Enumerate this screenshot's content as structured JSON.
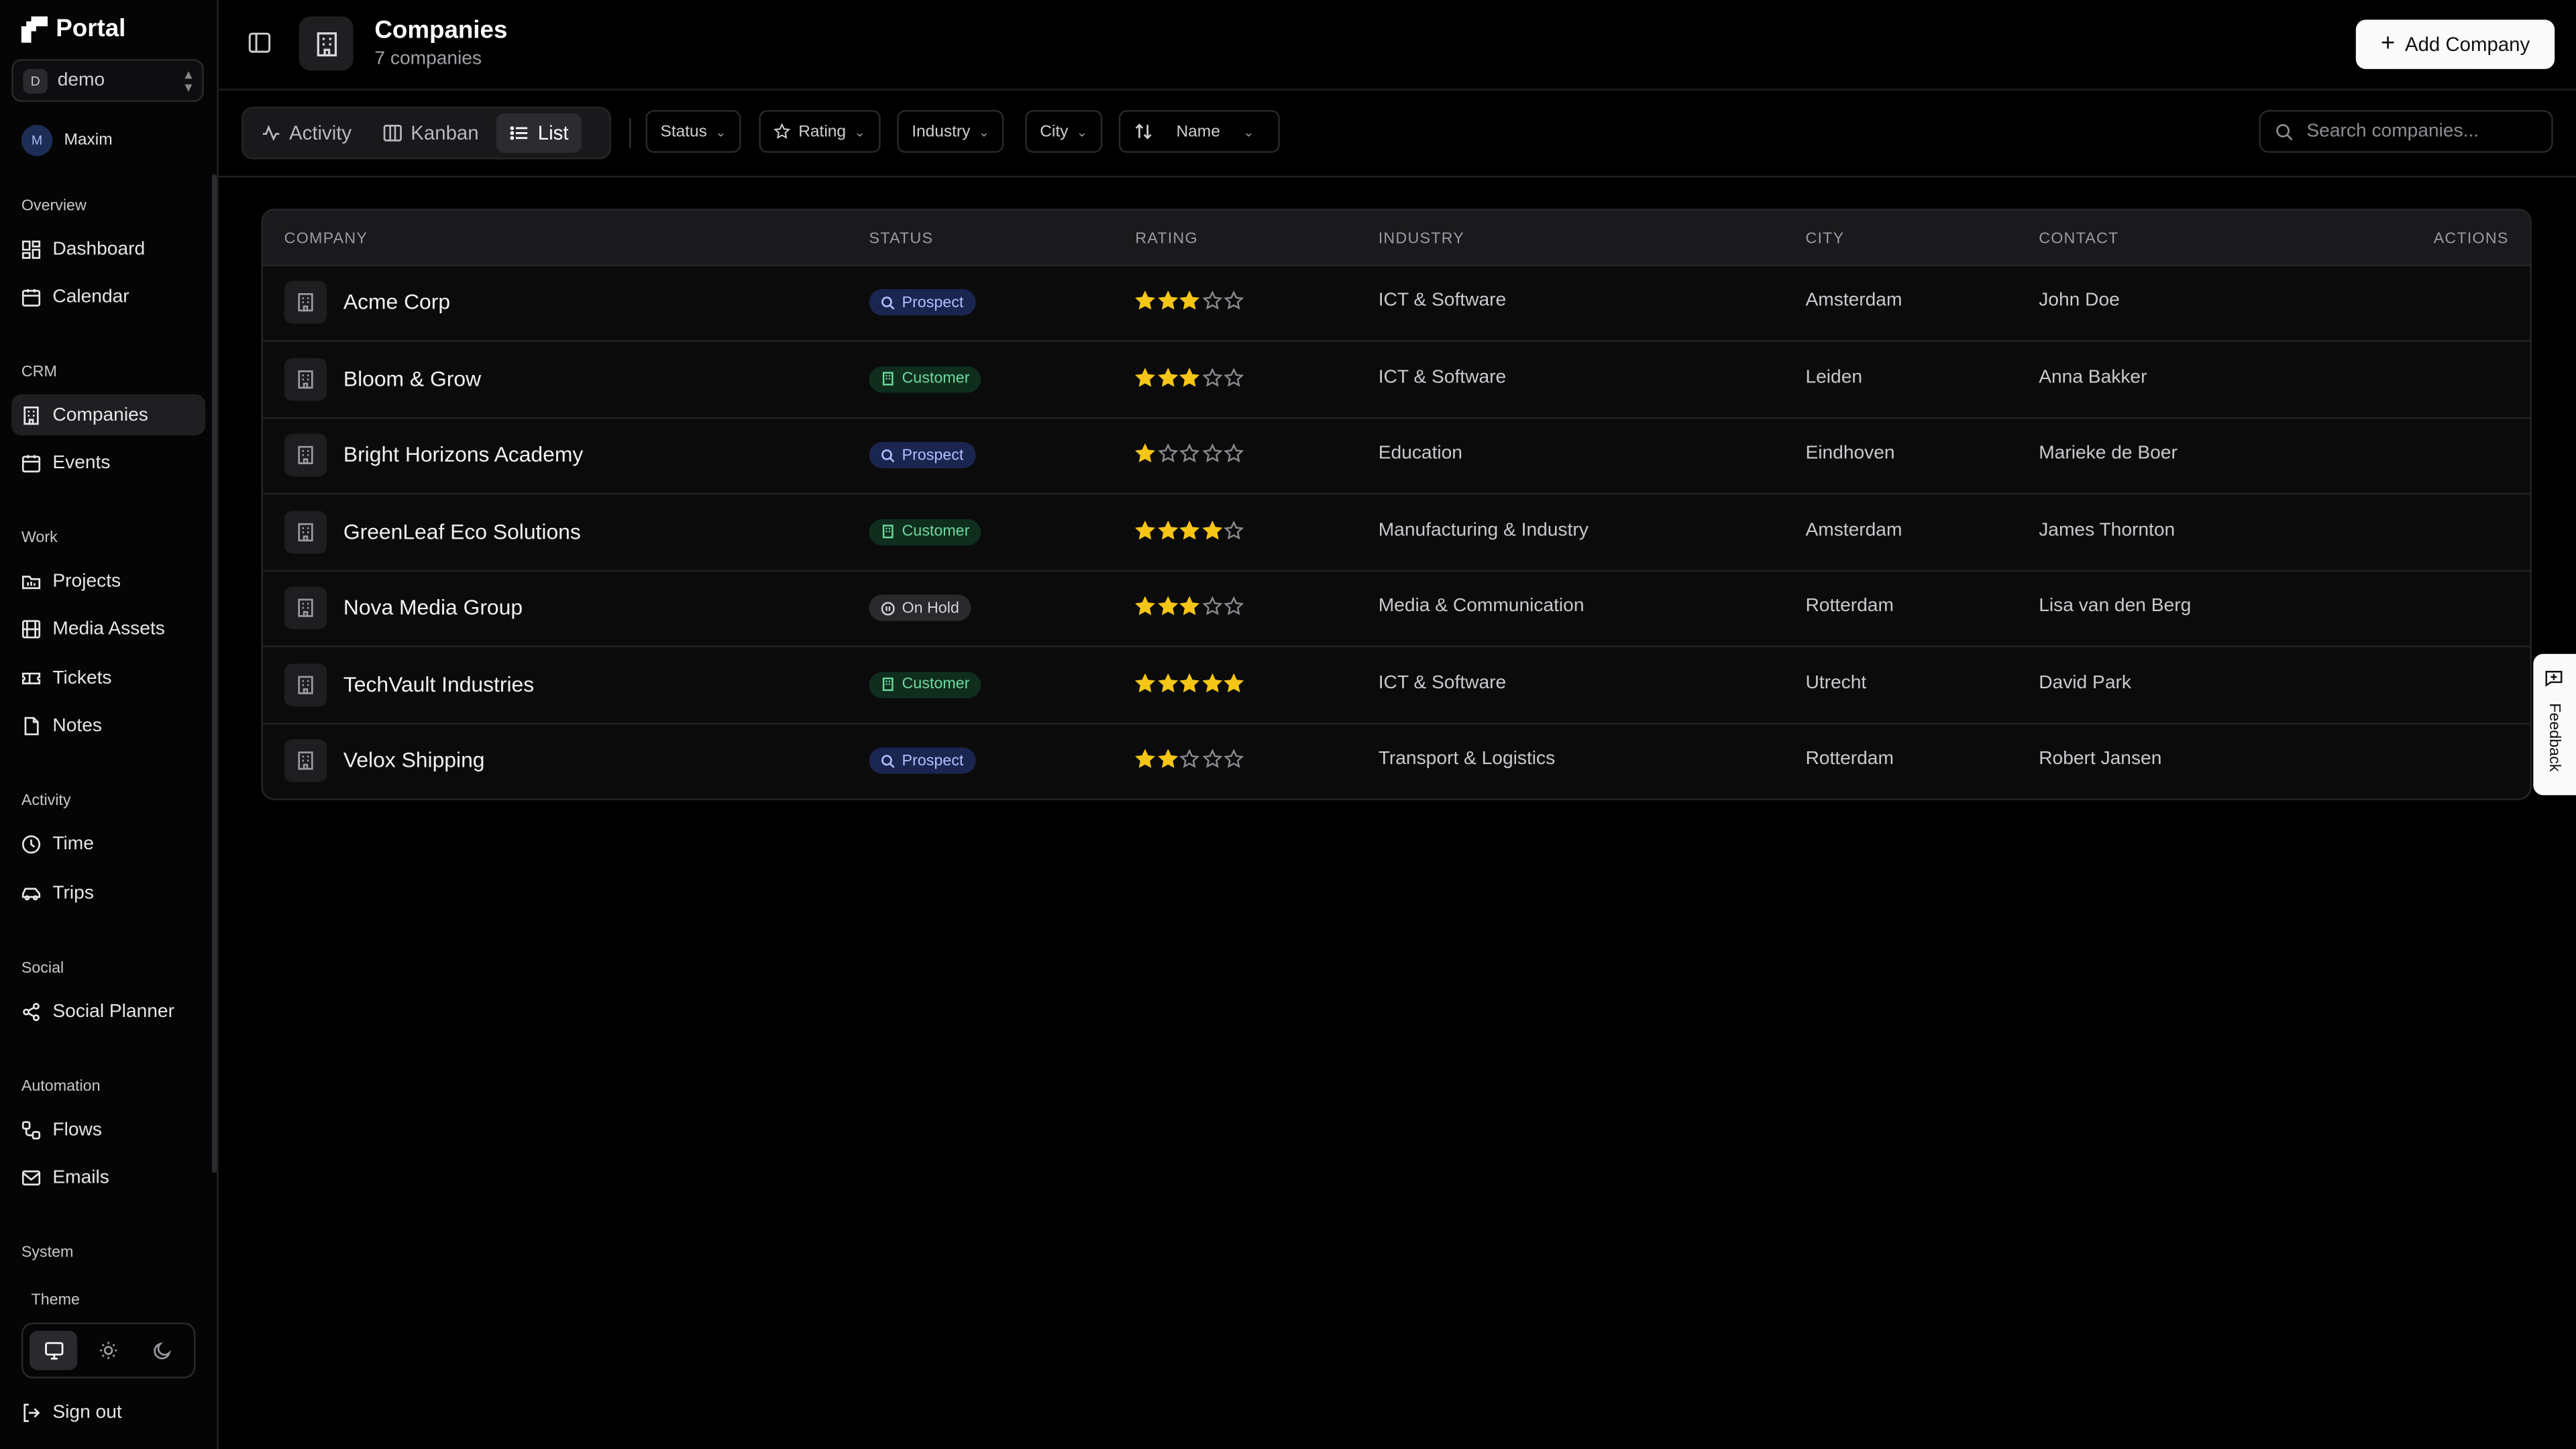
{
  "app": {
    "name": "Portal",
    "workspace_initial": "D",
    "workspace": "demo",
    "user_initial": "M",
    "user_name": "Maxim"
  },
  "sidebar": {
    "sections": {
      "overview": "Overview",
      "crm": "CRM",
      "work": "Work",
      "activity": "Activity",
      "social": "Social",
      "automation": "Automation",
      "system": "System"
    },
    "items": {
      "dashboard": "Dashboard",
      "calendar": "Calendar",
      "companies": "Companies",
      "events": "Events",
      "projects": "Projects",
      "media_assets": "Media Assets",
      "tickets": "Tickets",
      "notes": "Notes",
      "time": "Time",
      "trips": "Trips",
      "social_planner": "Social Planner",
      "flows": "Flows",
      "emails": "Emails"
    },
    "theme_label": "Theme",
    "theme_selected": "system",
    "sign_out": "Sign out"
  },
  "header": {
    "title": "Companies",
    "subtitle": "7 companies",
    "add_button": "Add Company"
  },
  "toolbar": {
    "views": {
      "activity": "Activity",
      "kanban": "Kanban",
      "list": "List"
    },
    "active_view": "List",
    "filters": {
      "status": "Status",
      "rating": "Rating",
      "industry": "Industry",
      "city": "City"
    },
    "sort": "Name",
    "search_placeholder": "Search companies..."
  },
  "table": {
    "columns": {
      "company": "COMPANY",
      "status": "STATUS",
      "rating": "RATING",
      "industry": "INDUSTRY",
      "city": "CITY",
      "contact": "CONTACT",
      "actions": "ACTIONS"
    },
    "rows": [
      {
        "company": "Acme Corp",
        "status": "Prospect",
        "rating": 3,
        "industry": "ICT & Software",
        "city": "Amsterdam",
        "contact": "John Doe"
      },
      {
        "company": "Bloom & Grow",
        "status": "Customer",
        "rating": 3,
        "industry": "ICT & Software",
        "city": "Leiden",
        "contact": "Anna Bakker"
      },
      {
        "company": "Bright Horizons Academy",
        "status": "Prospect",
        "rating": 1,
        "industry": "Education",
        "city": "Eindhoven",
        "contact": "Marieke de Boer"
      },
      {
        "company": "GreenLeaf Eco Solutions",
        "status": "Customer",
        "rating": 4,
        "industry": "Manufacturing & Industry",
        "city": "Amsterdam",
        "contact": "James Thornton"
      },
      {
        "company": "Nova Media Group",
        "status": "On Hold",
        "rating": 3,
        "industry": "Media & Communication",
        "city": "Rotterdam",
        "contact": "Lisa van den Berg"
      },
      {
        "company": "TechVault Industries",
        "status": "Customer",
        "rating": 5,
        "industry": "ICT & Software",
        "city": "Utrecht",
        "contact": "David Park"
      },
      {
        "company": "Velox Shipping",
        "status": "Prospect",
        "rating": 2,
        "industry": "Transport & Logistics",
        "city": "Rotterdam",
        "contact": "Robert Jansen"
      }
    ],
    "max_rating": 5
  },
  "feedback": {
    "label": "Feedback"
  },
  "colors": {
    "star": "#f5c518",
    "star_empty": "#8a8a90",
    "prospect": "#aebffd",
    "customer": "#6fd8a0",
    "on_hold": "#d3d3d6"
  }
}
